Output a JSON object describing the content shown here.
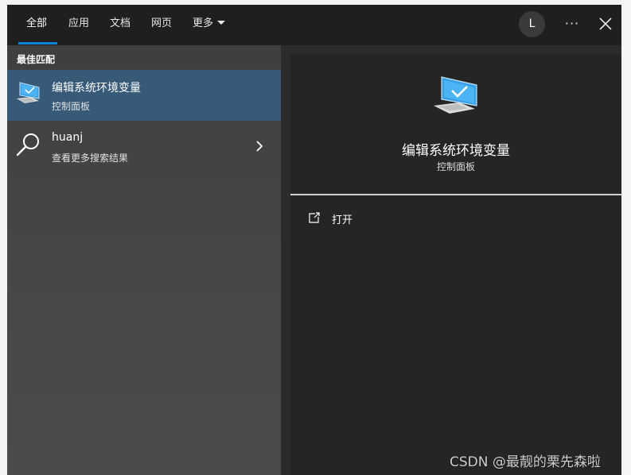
{
  "tabs": [
    {
      "label": "全部",
      "active": true
    },
    {
      "label": "应用"
    },
    {
      "label": "文档"
    },
    {
      "label": "网页"
    },
    {
      "label": "更多"
    }
  ],
  "avatar": {
    "initial": "L"
  },
  "menu": {
    "dots": "···"
  },
  "left_pane": {
    "section_label": "最佳匹配",
    "results": [
      {
        "title": "编辑系统环境变量",
        "subtitle": "控制面板",
        "icon": "monitor-check-icon",
        "selected": true
      },
      {
        "title": "huanj",
        "subtitle": "查看更多搜索结果",
        "icon": "search-icon"
      }
    ]
  },
  "detail": {
    "icon": "monitor-check-icon",
    "title": "编辑系统环境变量",
    "subtitle": "控制面板",
    "actions": [
      {
        "label": "打开",
        "icon": "open-external-icon"
      }
    ]
  },
  "watermark": "CSDN @最靓的栗先森啦",
  "colors": {
    "accent": "#0a84d6",
    "selected_row": "#375a78",
    "topbar": "#1f1f1f",
    "detail_bg": "#252525"
  }
}
